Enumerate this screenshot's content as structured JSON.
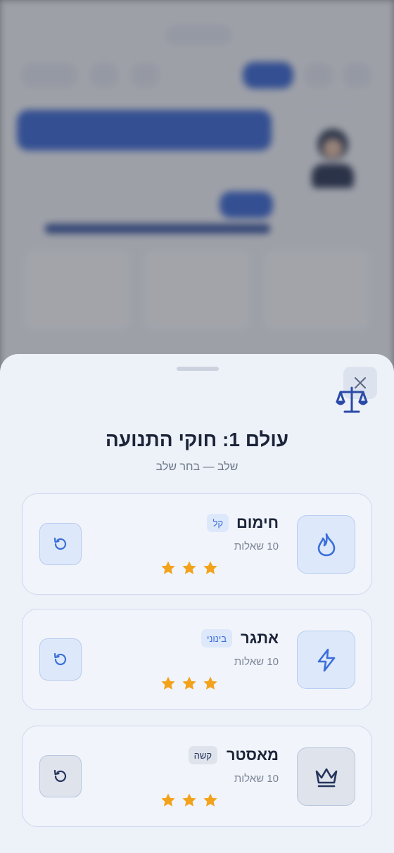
{
  "sheet": {
    "title": "עולם 1: חוקי התנועה",
    "subtitle": "שלב — בחר שלב",
    "close_icon": "close-icon",
    "world_icon": "scales-icon"
  },
  "levels": [
    {
      "name": "חימום",
      "difficulty": "קל",
      "questions": "10 שאלות",
      "stars_earned": 3,
      "stars_total": 3,
      "icon": "flame-icon",
      "accent": "#3b6fd8"
    },
    {
      "name": "אתגר",
      "difficulty": "בינוני",
      "questions": "10 שאלות",
      "stars_earned": 3,
      "stars_total": 3,
      "icon": "bolt-icon",
      "accent": "#3b6fd8"
    },
    {
      "name": "מאסטר",
      "difficulty": "קשה",
      "questions": "10 שאלות",
      "stars_earned": 3,
      "stars_total": 3,
      "icon": "crown-icon",
      "accent": "#25345c"
    }
  ],
  "colors": {
    "star": "#f2a21b",
    "primary": "#2f5fd0",
    "sheet_bg": "#edf1f8"
  }
}
